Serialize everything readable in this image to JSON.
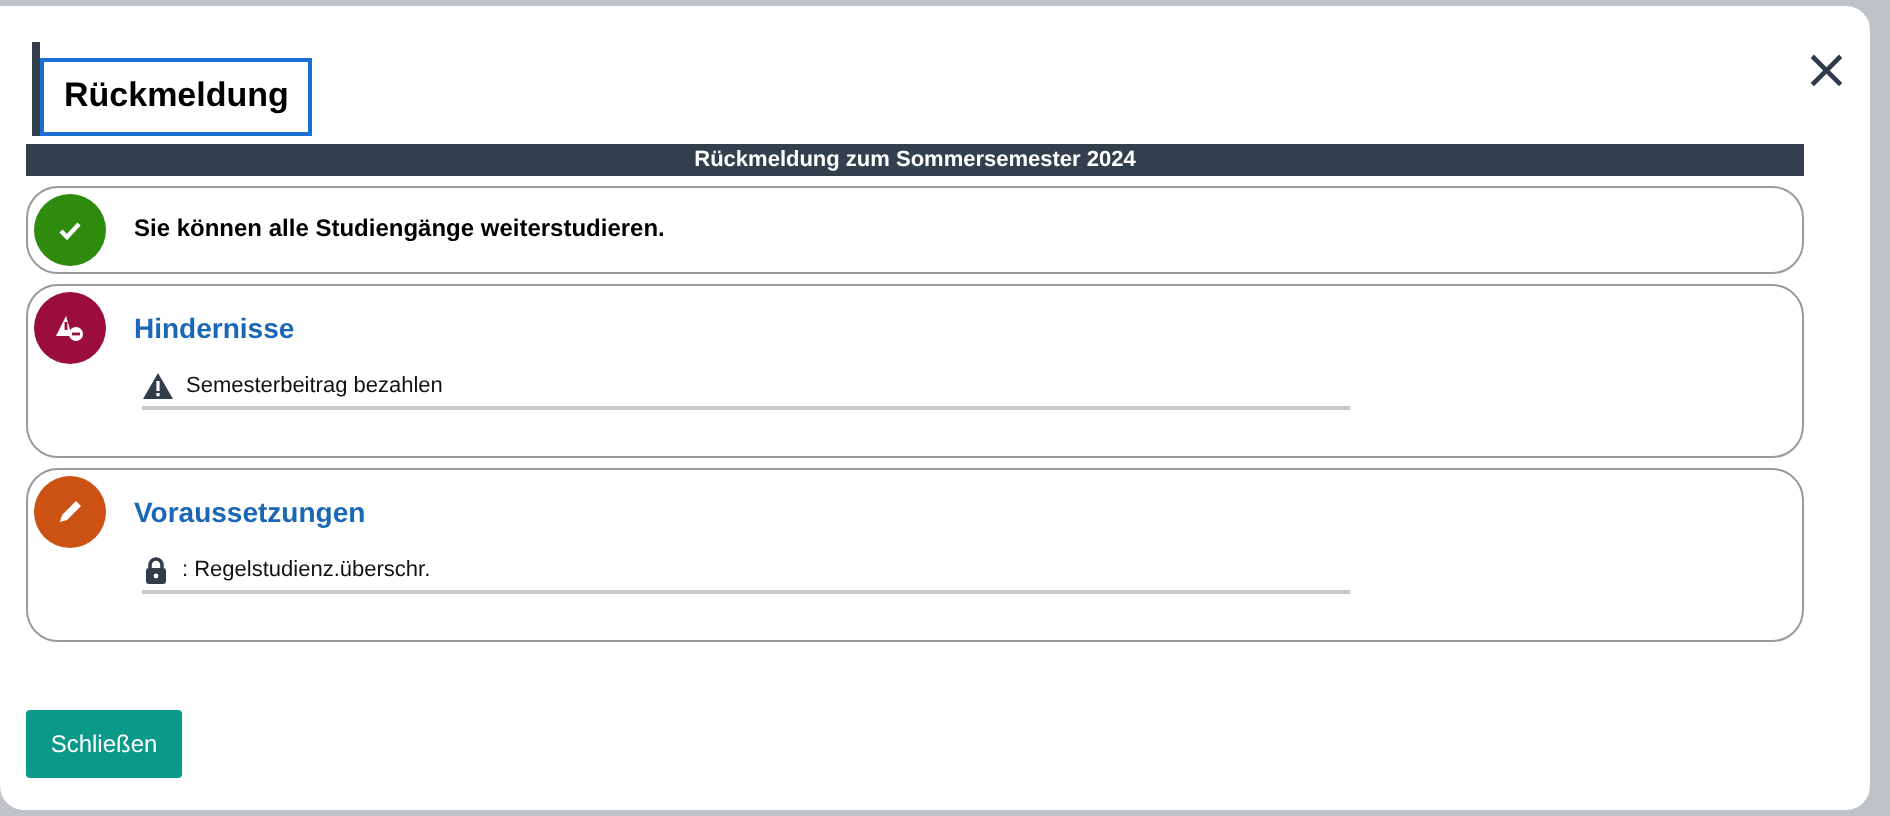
{
  "dialog": {
    "title": "Rückmeldung",
    "close_icon": "×"
  },
  "banner": "Rückmeldung zum Sommersemester 2024",
  "sections": [
    {
      "kind": "success",
      "color": "#2e8b0e",
      "text": "Sie können alle Studiengänge weiterstudieren."
    },
    {
      "kind": "obstacles",
      "color": "#9b0e3c",
      "title": "Hindernisse",
      "items": [
        {
          "kind": "warning",
          "text": "Semesterbeitrag bezahlen"
        }
      ]
    },
    {
      "kind": "prerequisites",
      "color": "#cc5214",
      "title": "Voraussetzungen",
      "items": [
        {
          "kind": "lock",
          "text": ": Regelstudienz.überschr."
        }
      ]
    }
  ],
  "buttons": [
    "Schließen"
  ]
}
